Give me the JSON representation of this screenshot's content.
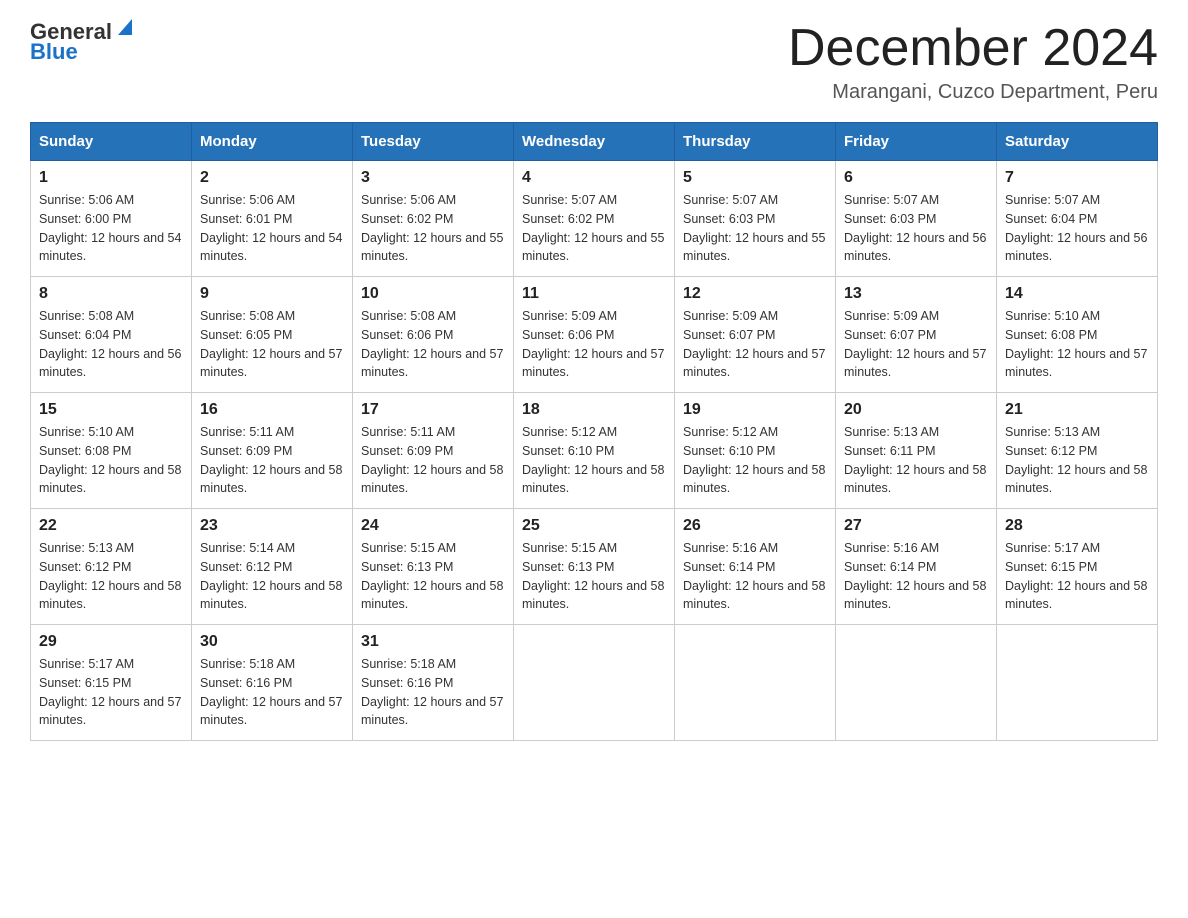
{
  "header": {
    "logo_line1": "General",
    "logo_line2": "Blue",
    "main_title": "December 2024",
    "subtitle": "Marangani, Cuzco Department, Peru"
  },
  "days_of_week": [
    "Sunday",
    "Monday",
    "Tuesday",
    "Wednesday",
    "Thursday",
    "Friday",
    "Saturday"
  ],
  "weeks": [
    [
      {
        "day": "1",
        "sunrise": "5:06 AM",
        "sunset": "6:00 PM",
        "daylight": "12 hours and 54 minutes."
      },
      {
        "day": "2",
        "sunrise": "5:06 AM",
        "sunset": "6:01 PM",
        "daylight": "12 hours and 54 minutes."
      },
      {
        "day": "3",
        "sunrise": "5:06 AM",
        "sunset": "6:02 PM",
        "daylight": "12 hours and 55 minutes."
      },
      {
        "day": "4",
        "sunrise": "5:07 AM",
        "sunset": "6:02 PM",
        "daylight": "12 hours and 55 minutes."
      },
      {
        "day": "5",
        "sunrise": "5:07 AM",
        "sunset": "6:03 PM",
        "daylight": "12 hours and 55 minutes."
      },
      {
        "day": "6",
        "sunrise": "5:07 AM",
        "sunset": "6:03 PM",
        "daylight": "12 hours and 56 minutes."
      },
      {
        "day": "7",
        "sunrise": "5:07 AM",
        "sunset": "6:04 PM",
        "daylight": "12 hours and 56 minutes."
      }
    ],
    [
      {
        "day": "8",
        "sunrise": "5:08 AM",
        "sunset": "6:04 PM",
        "daylight": "12 hours and 56 minutes."
      },
      {
        "day": "9",
        "sunrise": "5:08 AM",
        "sunset": "6:05 PM",
        "daylight": "12 hours and 57 minutes."
      },
      {
        "day": "10",
        "sunrise": "5:08 AM",
        "sunset": "6:06 PM",
        "daylight": "12 hours and 57 minutes."
      },
      {
        "day": "11",
        "sunrise": "5:09 AM",
        "sunset": "6:06 PM",
        "daylight": "12 hours and 57 minutes."
      },
      {
        "day": "12",
        "sunrise": "5:09 AM",
        "sunset": "6:07 PM",
        "daylight": "12 hours and 57 minutes."
      },
      {
        "day": "13",
        "sunrise": "5:09 AM",
        "sunset": "6:07 PM",
        "daylight": "12 hours and 57 minutes."
      },
      {
        "day": "14",
        "sunrise": "5:10 AM",
        "sunset": "6:08 PM",
        "daylight": "12 hours and 57 minutes."
      }
    ],
    [
      {
        "day": "15",
        "sunrise": "5:10 AM",
        "sunset": "6:08 PM",
        "daylight": "12 hours and 58 minutes."
      },
      {
        "day": "16",
        "sunrise": "5:11 AM",
        "sunset": "6:09 PM",
        "daylight": "12 hours and 58 minutes."
      },
      {
        "day": "17",
        "sunrise": "5:11 AM",
        "sunset": "6:09 PM",
        "daylight": "12 hours and 58 minutes."
      },
      {
        "day": "18",
        "sunrise": "5:12 AM",
        "sunset": "6:10 PM",
        "daylight": "12 hours and 58 minutes."
      },
      {
        "day": "19",
        "sunrise": "5:12 AM",
        "sunset": "6:10 PM",
        "daylight": "12 hours and 58 minutes."
      },
      {
        "day": "20",
        "sunrise": "5:13 AM",
        "sunset": "6:11 PM",
        "daylight": "12 hours and 58 minutes."
      },
      {
        "day": "21",
        "sunrise": "5:13 AM",
        "sunset": "6:12 PM",
        "daylight": "12 hours and 58 minutes."
      }
    ],
    [
      {
        "day": "22",
        "sunrise": "5:13 AM",
        "sunset": "6:12 PM",
        "daylight": "12 hours and 58 minutes."
      },
      {
        "day": "23",
        "sunrise": "5:14 AM",
        "sunset": "6:12 PM",
        "daylight": "12 hours and 58 minutes."
      },
      {
        "day": "24",
        "sunrise": "5:15 AM",
        "sunset": "6:13 PM",
        "daylight": "12 hours and 58 minutes."
      },
      {
        "day": "25",
        "sunrise": "5:15 AM",
        "sunset": "6:13 PM",
        "daylight": "12 hours and 58 minutes."
      },
      {
        "day": "26",
        "sunrise": "5:16 AM",
        "sunset": "6:14 PM",
        "daylight": "12 hours and 58 minutes."
      },
      {
        "day": "27",
        "sunrise": "5:16 AM",
        "sunset": "6:14 PM",
        "daylight": "12 hours and 58 minutes."
      },
      {
        "day": "28",
        "sunrise": "5:17 AM",
        "sunset": "6:15 PM",
        "daylight": "12 hours and 58 minutes."
      }
    ],
    [
      {
        "day": "29",
        "sunrise": "5:17 AM",
        "sunset": "6:15 PM",
        "daylight": "12 hours and 57 minutes."
      },
      {
        "day": "30",
        "sunrise": "5:18 AM",
        "sunset": "6:16 PM",
        "daylight": "12 hours and 57 minutes."
      },
      {
        "day": "31",
        "sunrise": "5:18 AM",
        "sunset": "6:16 PM",
        "daylight": "12 hours and 57 minutes."
      },
      null,
      null,
      null,
      null
    ]
  ]
}
